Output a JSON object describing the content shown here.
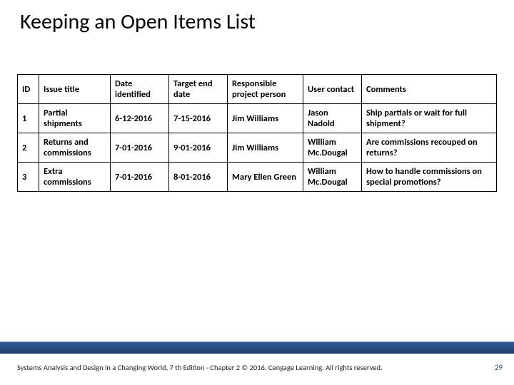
{
  "title": "Keeping an Open Items List",
  "table": {
    "headers": [
      "ID",
      "Issue title",
      "Date identified",
      "Target end date",
      "Responsible project person",
      "User contact",
      "Comments"
    ],
    "rows": [
      {
        "id": "1",
        "issue": "Partial shipments",
        "date": "6-12-2016",
        "target": "7-15-2016",
        "responsible": "Jim Williams",
        "user": "Jason Nadold",
        "comments": "Ship partials or wait for full shipment?"
      },
      {
        "id": "2",
        "issue": "Returns and commissions",
        "date": "7-01-2016",
        "target": "9-01-2016",
        "responsible": "Jim Williams",
        "user": "William Mc.Dougal",
        "comments": "Are commissions recouped on returns?"
      },
      {
        "id": "3",
        "issue": "Extra commissions",
        "date": "7-01-2016",
        "target": "8-01-2016",
        "responsible": "Mary Ellen Green",
        "user": "William Mc.Dougal",
        "comments": "How to handle commissions on special promotions?"
      }
    ]
  },
  "footer": "Systems Analysis and Design in a Changing World, 7 th Edition - Chapter 2 © 2016. Cengage Learning. All rights reserved.",
  "page": "29"
}
